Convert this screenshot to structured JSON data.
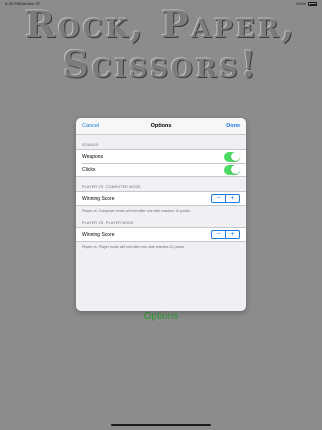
{
  "status_bar": {
    "time": "8:35 PM",
    "date": "Sat Mar 17",
    "wifi_icon": "wifi-icon",
    "battery_percent_text": "100%",
    "battery_level": 1.0
  },
  "background": {
    "title_line1": "Rock, Paper,",
    "title_line2": "Scissors!",
    "options_label": "Options",
    "options_color": "#2a9a2a"
  },
  "modal": {
    "nav": {
      "cancel_label": "Cancel",
      "title": "Options",
      "done_label": "Done"
    },
    "sounds": {
      "header": "SOUNDS",
      "items": [
        {
          "label": "Weapons",
          "on": true
        },
        {
          "label": "Clicks",
          "on": true
        }
      ]
    },
    "pvc": {
      "header": "PLAYER VS. COMPUTER MODE",
      "row_label": "Winning Score",
      "minus": "−",
      "plus": "+",
      "footer": "Player vs. Computer mode will end after one side reaches 10 points."
    },
    "pvp": {
      "header": "PLAYER VS. PLAYER MODE",
      "row_label": "Winning Score",
      "minus": "−",
      "plus": "+",
      "footer": "Player vs. Player mode will end after one side reaches 10 points."
    }
  },
  "colors": {
    "accent": "#1f7ae0",
    "toggle_on": "#4cd964",
    "background": "#8c8c8c"
  }
}
